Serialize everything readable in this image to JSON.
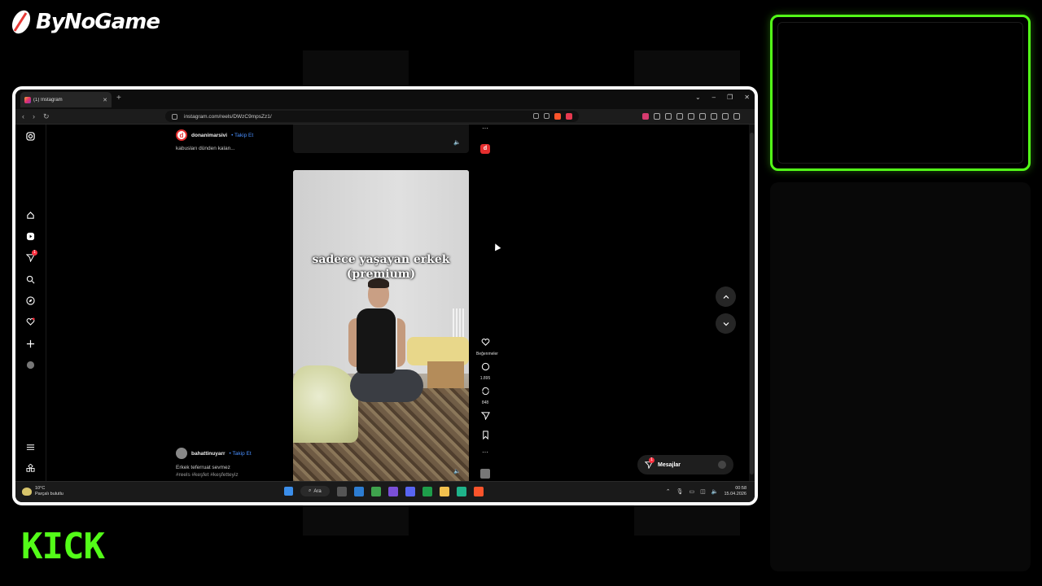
{
  "overlay": {
    "brand": "ByNoGame",
    "platform": "KICK",
    "accent_green": "#53fc18"
  },
  "browser": {
    "tab_title": "(1) Instagram",
    "url": "instagram.com/reels/DWzC9mpsZz1/",
    "window_controls": [
      "⌄",
      "–",
      "❐",
      "✕"
    ]
  },
  "reels": {
    "top": {
      "username": "donanimarsivi",
      "follow_label": "• Takip Et",
      "caption": "kabusları dünden kalan..."
    },
    "current": {
      "overlay_text_line1": "sadece yaşayan erkek",
      "overlay_text_line2": "(premium)",
      "username": "bahattinuyarr",
      "follow_label": "• Takip Et",
      "caption_line1": "Erkek teferruat sevmez",
      "caption_line2": "#reels #keşfet #keşfetteyiz",
      "likes_label": "Beğenmeler",
      "comments_count": "1.895",
      "reposts_count": "848"
    }
  },
  "sidebar": {
    "notification_count": "1"
  },
  "messages": {
    "label": "Mesajlar",
    "badge": "1"
  },
  "taskbar": {
    "weather_temp": "10°C",
    "weather_desc": "Parçalı bulutlu",
    "search_label": "Ara",
    "time": "00:58",
    "date": "15.04.2026"
  }
}
